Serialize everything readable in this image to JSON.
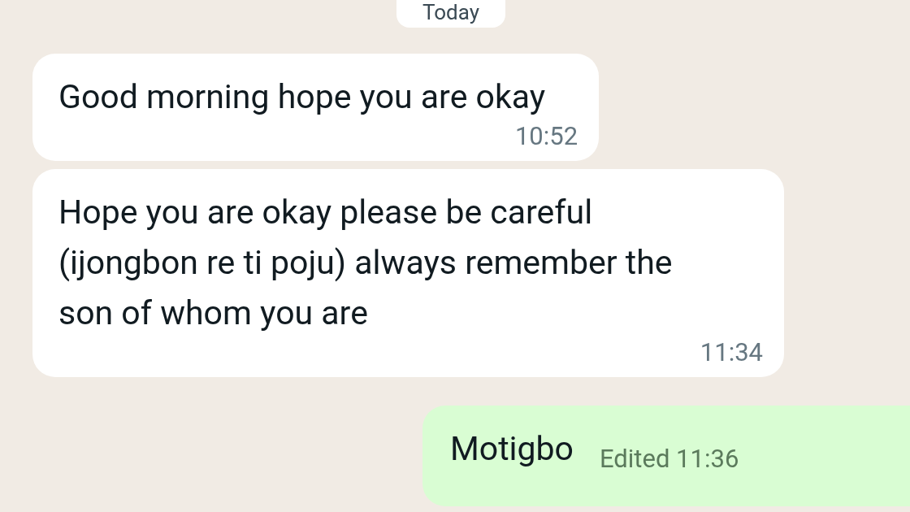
{
  "date_divider": "Today",
  "messages": [
    {
      "kind": "incoming",
      "text": "Good morning hope you are okay",
      "time": "10:52"
    },
    {
      "kind": "incoming",
      "text": "Hope you are okay please be careful (ijongbon re ti poju) always remember the son of whom you are",
      "time": "11:34"
    },
    {
      "kind": "outgoing",
      "text": "Motigbo",
      "time": "Edited 11:36"
    }
  ]
}
